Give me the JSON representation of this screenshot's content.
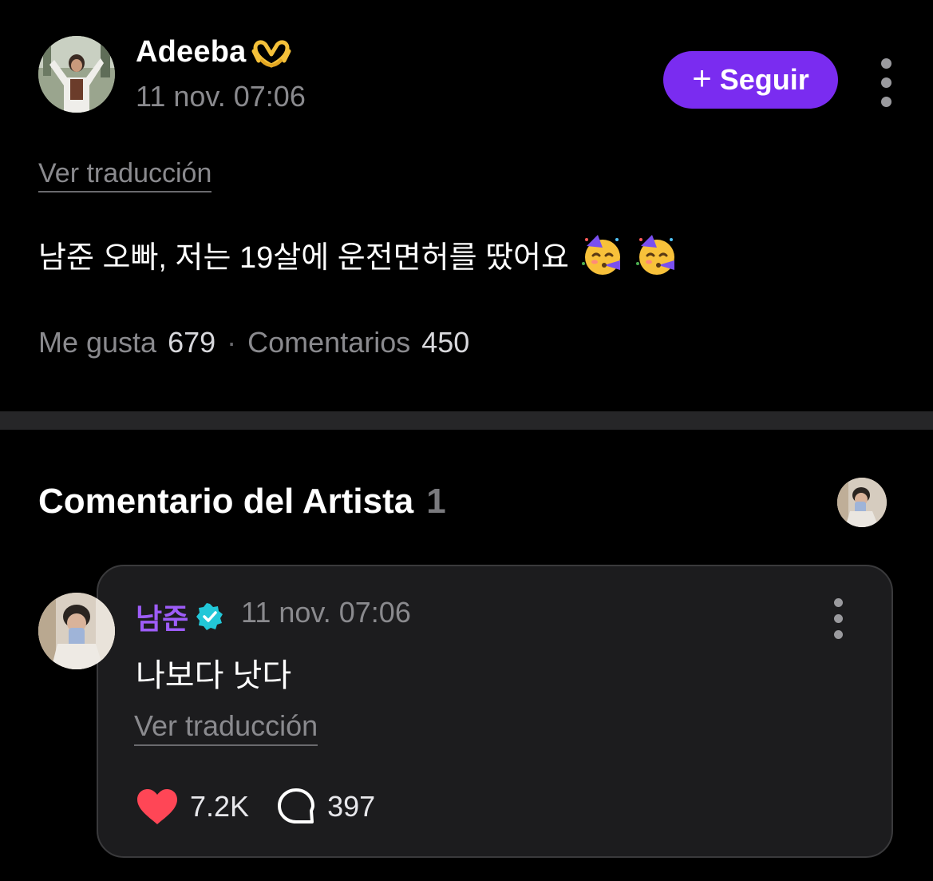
{
  "post": {
    "author": "Adeeba",
    "author_emoji": "heart-hands-icon",
    "timestamp": "11 nov. 07:06",
    "follow_label": "Seguir",
    "translate_label": "Ver traducción",
    "body": "남준 오빠, 저는 19살에 운전면허를 땄어요",
    "body_emojis": [
      "partying-face-icon",
      "partying-face-icon"
    ],
    "likes_label": "Me gusta",
    "likes_count": "679",
    "separator": "·",
    "comments_label": "Comentarios",
    "comments_count": "450"
  },
  "artist_section": {
    "title": "Comentario del Artista",
    "count": "1"
  },
  "artist_comment": {
    "author": "남준",
    "verified": true,
    "timestamp": "11 nov. 07:06",
    "text": "나보다 낫다",
    "translate_label": "Ver traducción",
    "likes": "7.2K",
    "replies": "397"
  },
  "colors": {
    "background": "#000000",
    "accent_purple": "#7a2cf0",
    "artist_name": "#9d5cf7",
    "verified_badge": "#22c7d8",
    "heart": "#ff4656",
    "muted_text": "#8a8a8e",
    "card_bg": "#1c1c1e",
    "divider": "#262628"
  }
}
